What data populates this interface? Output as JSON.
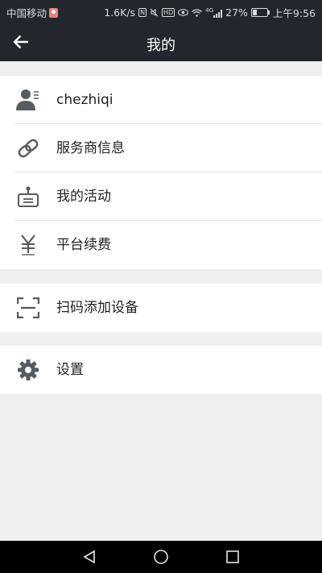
{
  "status_bar": {
    "carrier": "中国移动",
    "speed": "1.6K/s",
    "network": "4G",
    "battery": "27%",
    "time": "上午9:56"
  },
  "header": {
    "title": "我的"
  },
  "profile": {
    "username": "chezhiqi"
  },
  "menu": {
    "provider_info": "服务商信息",
    "my_activities": "我的活动",
    "platform_renewal": "平台续费",
    "scan_add_device": "扫码添加设备",
    "settings": "设置"
  },
  "colors": {
    "header_bg": "#23272d",
    "page_bg": "#efefef",
    "icon": "#555b62"
  },
  "icons": {
    "back": "arrow-left-icon",
    "profile": "user-card-icon",
    "provider": "link-icon",
    "activity": "activity-badge-icon",
    "renewal": "yen-icon",
    "scan": "scan-frame-icon",
    "settings": "gear-icon"
  }
}
